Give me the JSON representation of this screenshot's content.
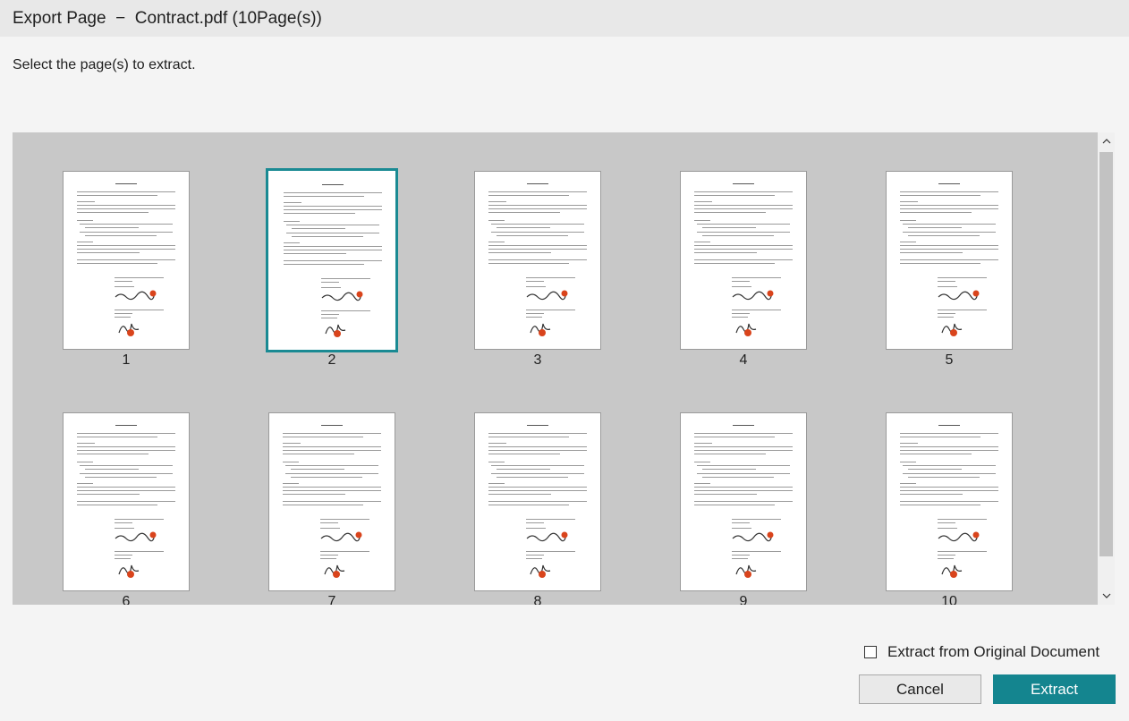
{
  "dialog": {
    "title": "Export Page  −  Contract.pdf (10Page(s))",
    "instruction": "Select the page(s) to extract."
  },
  "pages": [
    {
      "number": "1",
      "selected": false
    },
    {
      "number": "2",
      "selected": true
    },
    {
      "number": "3",
      "selected": false
    },
    {
      "number": "4",
      "selected": false
    },
    {
      "number": "5",
      "selected": false
    },
    {
      "number": "6",
      "selected": false
    },
    {
      "number": "7",
      "selected": false
    },
    {
      "number": "8",
      "selected": false
    },
    {
      "number": "9",
      "selected": false
    },
    {
      "number": "10",
      "selected": false
    }
  ],
  "scrollbar": {
    "up_icon": "chevron-up-icon",
    "down_icon": "chevron-down-icon"
  },
  "options": {
    "extract_original_label": "Extract from Original Document",
    "extract_original_checked": false
  },
  "buttons": {
    "cancel": "Cancel",
    "extract": "Extract"
  },
  "colors": {
    "accent": "#14858f",
    "selection_border": "#1a8a93",
    "panel_bg": "#c8c8c8",
    "titlebar_bg": "#e8e8e8"
  }
}
